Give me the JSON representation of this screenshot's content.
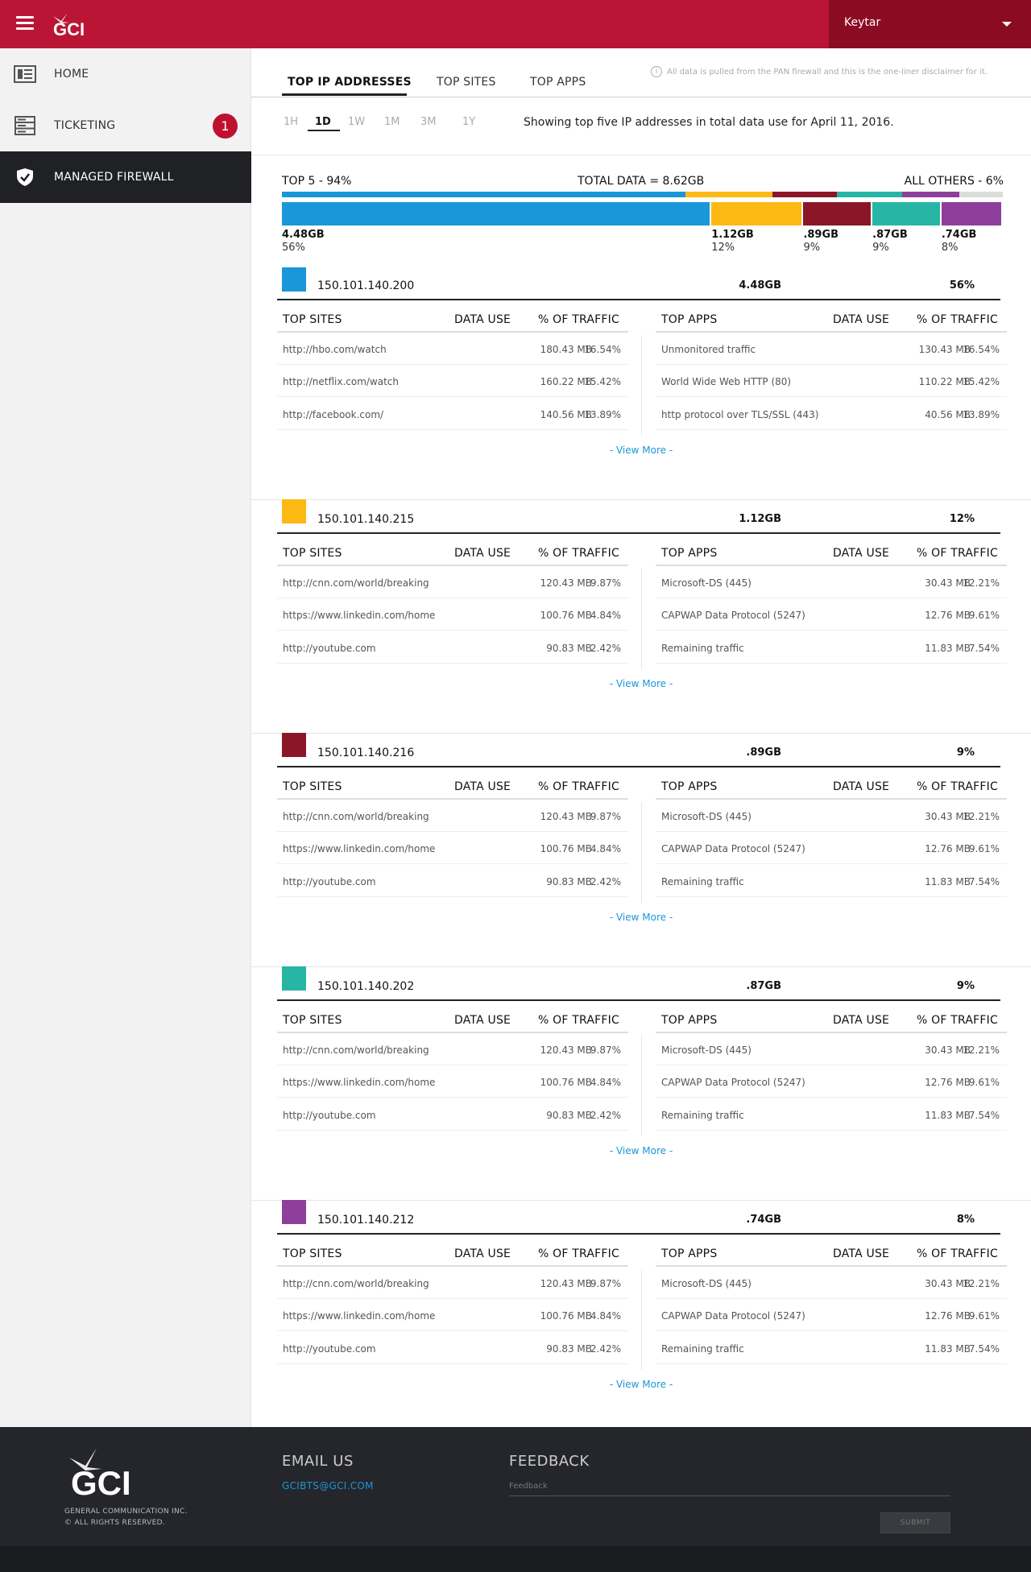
{
  "header": {
    "logo": "GCI",
    "user": "Keytar"
  },
  "sidebar": {
    "items": [
      {
        "label": "HOME",
        "icon": "dashboard-icon"
      },
      {
        "label": "TICKETING",
        "icon": "server-list-icon",
        "badge": "1"
      },
      {
        "label": "MANAGED FIREWALL",
        "icon": "shield-check-icon"
      }
    ]
  },
  "tabs": [
    "TOP IP ADDRESSES",
    "TOP SITES",
    "TOP APPS"
  ],
  "disclaimer": "All data is pulled from the PAN firewall and this is the one-liner disclaimer for it.",
  "ranges": [
    "1H",
    "1D",
    "1W",
    "1M",
    "3M",
    "1Y"
  ],
  "selected_range": "1D",
  "range_desc": "Showing top five IP addresses in total data use for April 11, 2016.",
  "summary": {
    "top5": "TOP 5 - 94%",
    "total": "TOTAL DATA = 8.62GB",
    "others": "ALL OTHERS - 6%",
    "segments": [
      {
        "gb": "4.48GB",
        "pct": "56%",
        "value": 56,
        "color": "#1a97d8"
      },
      {
        "gb": "1.12GB",
        "pct": "12%",
        "value": 12,
        "color": "#fdb913"
      },
      {
        "gb": ".89GB",
        "pct": "9%",
        "value": 9,
        "color": "#8b1627"
      },
      {
        "gb": ".87GB",
        "pct": "9%",
        "value": 9,
        "color": "#27b6a5"
      },
      {
        "gb": ".74GB",
        "pct": "8%",
        "value": 8,
        "color": "#8e3f9c"
      },
      {
        "value": 6,
        "color": "#dcdcdc"
      }
    ]
  },
  "table_headers": {
    "sites": "TOP SITES",
    "apps": "TOP APPS",
    "data_use": "DATA USE",
    "traffic": "% OF TRAFFIC"
  },
  "view_more": "-  View More  -",
  "ips": [
    {
      "address": "150.101.140.200",
      "data": "4.48GB",
      "pct": "56%",
      "color": "#1a97d8",
      "sites": [
        [
          "http://hbo.com/watch",
          "180.43 MB",
          "16.54%"
        ],
        [
          "http://netflix.com/watch",
          "160.22 MB",
          "15.42%"
        ],
        [
          "http://facebook.com/",
          "140.56 MB",
          "13.89%"
        ]
      ],
      "apps": [
        [
          "Unmonitored traffic",
          "130.43 MB",
          "16.54%"
        ],
        [
          "World Wide Web HTTP (80)",
          "110.22 MB",
          "15.42%"
        ],
        [
          "http protocol over TLS/SSL (443)",
          "40.56 MB",
          "13.89%"
        ]
      ]
    },
    {
      "address": "150.101.140.215",
      "data": "1.12GB",
      "pct": "12%",
      "color": "#fdb913",
      "sites": [
        [
          "http://cnn.com/world/breaking",
          "120.43 MB",
          "9.87%"
        ],
        [
          "https://www.linkedin.com/home",
          "100.76 MB",
          "4.84%"
        ],
        [
          "http://youtube.com",
          "90.83 MB",
          "2.42%"
        ]
      ],
      "apps": [
        [
          "Microsoft-DS (445)",
          "30.43 MB",
          "12.21%"
        ],
        [
          "CAPWAP Data Protocol (5247)",
          "12.76 MB",
          "9.61%"
        ],
        [
          "Remaining traffic",
          "11.83 MB",
          "7.54%"
        ]
      ]
    },
    {
      "address": "150.101.140.216",
      "data": ".89GB",
      "pct": "9%",
      "color": "#8b1627",
      "sites": [
        [
          "http://cnn.com/world/breaking",
          "120.43 MB",
          "9.87%"
        ],
        [
          "https://www.linkedin.com/home",
          "100.76 MB",
          "4.84%"
        ],
        [
          "http://youtube.com",
          "90.83 MB",
          "2.42%"
        ]
      ],
      "apps": [
        [
          "Microsoft-DS (445)",
          "30.43 MB",
          "12.21%"
        ],
        [
          "CAPWAP Data Protocol (5247)",
          "12.76 MB",
          "9.61%"
        ],
        [
          "Remaining traffic",
          "11.83 MB",
          "7.54%"
        ]
      ]
    },
    {
      "address": "150.101.140.202",
      "data": ".87GB",
      "pct": "9%",
      "color": "#27b6a5",
      "sites": [
        [
          "http://cnn.com/world/breaking",
          "120.43 MB",
          "9.87%"
        ],
        [
          "https://www.linkedin.com/home",
          "100.76 MB",
          "4.84%"
        ],
        [
          "http://youtube.com",
          "90.83 MB",
          "2.42%"
        ]
      ],
      "apps": [
        [
          "Microsoft-DS (445)",
          "30.43 MB",
          "12.21%"
        ],
        [
          "CAPWAP Data Protocol (5247)",
          "12.76 MB",
          "9.61%"
        ],
        [
          "Remaining traffic",
          "11.83 MB",
          "7.54%"
        ]
      ]
    },
    {
      "address": "150.101.140.212",
      "data": ".74GB",
      "pct": "8%",
      "color": "#8e3f9c",
      "sites": [
        [
          "http://cnn.com/world/breaking",
          "120.43 MB",
          "9.87%"
        ],
        [
          "https://www.linkedin.com/home",
          "100.76 MB",
          "4.84%"
        ],
        [
          "http://youtube.com",
          "90.83 MB",
          "2.42%"
        ]
      ],
      "apps": [
        [
          "Microsoft-DS (445)",
          "30.43 MB",
          "12.21%"
        ],
        [
          "CAPWAP Data Protocol (5247)",
          "12.76 MB",
          "9.61%"
        ],
        [
          "Remaining traffic",
          "11.83 MB",
          "7.54%"
        ]
      ]
    }
  ],
  "footer": {
    "logo": "GCI",
    "company": "GENERAL COMMUNICATION INC.",
    "rights": "© ALL RIGHTS RESERVED.",
    "email_title": "EMAIL US",
    "email": "GCIBTS@GCI.COM",
    "feedback_title": "FEEDBACK",
    "feedback_placeholder": "Feedback",
    "submit": "SUBMIT"
  }
}
